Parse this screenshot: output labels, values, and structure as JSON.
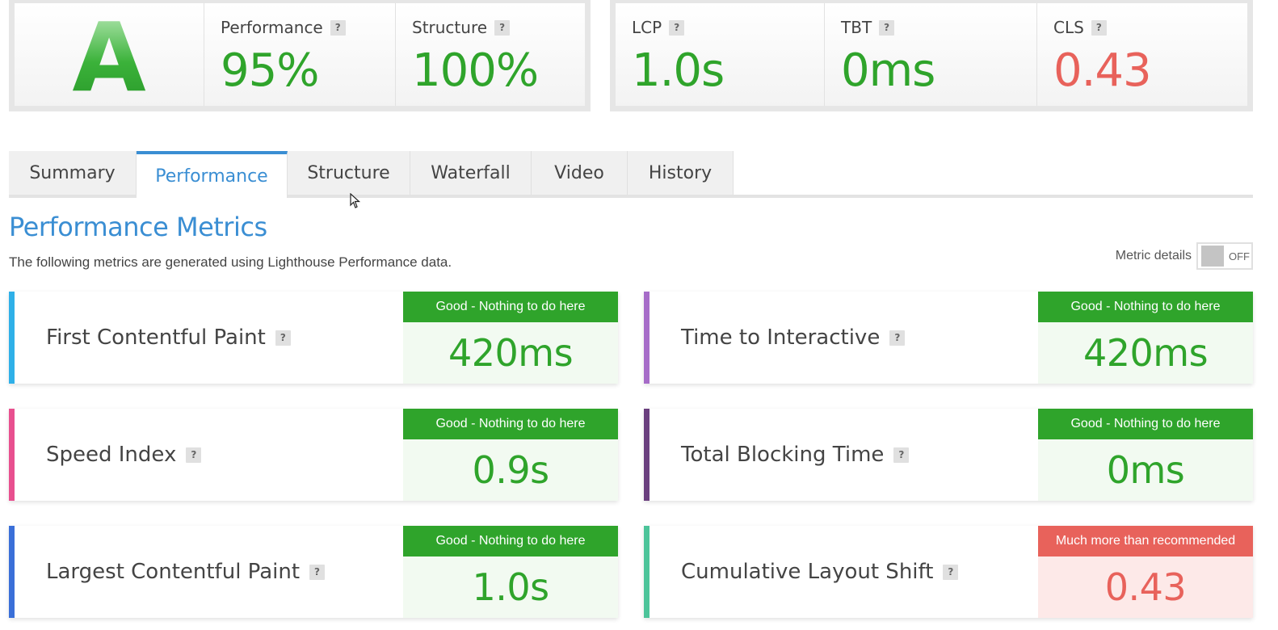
{
  "grade": "A",
  "header": {
    "left": [
      {
        "label": "Performance",
        "help": "?",
        "value": "95%",
        "status": "good"
      },
      {
        "label": "Structure",
        "help": "?",
        "value": "100%",
        "status": "good"
      }
    ],
    "right": [
      {
        "label": "LCP",
        "help": "?",
        "value": "1.0s",
        "status": "good"
      },
      {
        "label": "TBT",
        "help": "?",
        "value": "0ms",
        "status": "good"
      },
      {
        "label": "CLS",
        "help": "?",
        "value": "0.43",
        "status": "bad"
      }
    ]
  },
  "tabs": [
    {
      "label": "Summary",
      "active": false
    },
    {
      "label": "Performance",
      "active": true
    },
    {
      "label": "Structure",
      "active": false
    },
    {
      "label": "Waterfall",
      "active": false
    },
    {
      "label": "Video",
      "active": false
    },
    {
      "label": "History",
      "active": false
    }
  ],
  "section": {
    "title": "Performance Metrics",
    "description": "The following metrics are generated using Lighthouse Performance data."
  },
  "toggle": {
    "label": "Metric details",
    "state": "OFF"
  },
  "colors": {
    "accent": "#3a8ed3",
    "good": "#2fa42b",
    "bad": "#e8625b"
  },
  "metrics": [
    {
      "name": "First Contentful Paint",
      "help": "?",
      "status_text": "Good - Nothing to do here",
      "value": "420ms",
      "status": "good",
      "color": "#2fb0e8"
    },
    {
      "name": "Time to Interactive",
      "help": "?",
      "status_text": "Good - Nothing to do here",
      "value": "420ms",
      "status": "good",
      "color": "#a66cc8"
    },
    {
      "name": "Speed Index",
      "help": "?",
      "status_text": "Good - Nothing to do here",
      "value": "0.9s",
      "status": "good",
      "color": "#e8508f"
    },
    {
      "name": "Total Blocking Time",
      "help": "?",
      "status_text": "Good - Nothing to do here",
      "value": "0ms",
      "status": "good",
      "color": "#6a3f7e"
    },
    {
      "name": "Largest Contentful Paint",
      "help": "?",
      "status_text": "Good - Nothing to do here",
      "value": "1.0s",
      "status": "good",
      "color": "#3a6fd8"
    },
    {
      "name": "Cumulative Layout Shift",
      "help": "?",
      "status_text": "Much more than recommended",
      "value": "0.43",
      "status": "bad",
      "color": "#4cc49a"
    }
  ]
}
